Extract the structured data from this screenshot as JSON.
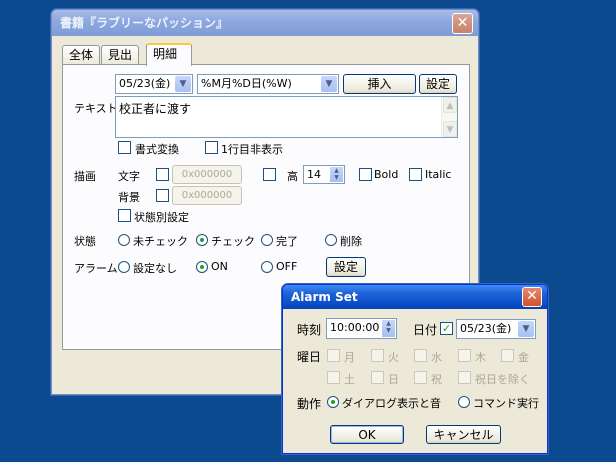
{
  "main": {
    "title": "書籍『ラブリーなパッション』",
    "tabs": [
      "全体",
      "見出",
      "明細"
    ],
    "date_value": "05/23(金)",
    "format_value": "%M月%D日(%W)",
    "insert_label": "挿入",
    "settings_label": "設定",
    "text_label": "テキスト",
    "text_value": "校正者に渡す",
    "format_convert_label": "書式変換",
    "hide_first_line_label": "1行目非表示",
    "draw_label": "描画",
    "char_label": "文字",
    "char_color": "0x000000",
    "height_label": "高",
    "height_value": "14",
    "bold_label": "Bold",
    "italic_label": "Italic",
    "bg_label": "背景",
    "bg_color": "0x000000",
    "state_setting_label": "状態別設定",
    "state_label": "状態",
    "state_options": [
      "未チェック",
      "チェック",
      "完了",
      "削除"
    ],
    "alarm_label": "アラーム",
    "alarm_options": [
      "設定なし",
      "ON",
      "OFF"
    ],
    "alarm_settings_label": "設定"
  },
  "alarm": {
    "title": "Alarm Set",
    "time_label": "時刻",
    "time_value": "10:00:00",
    "date_label": "日付",
    "date_value": "05/23(金)",
    "weekday_label": "曜日",
    "weekdays_row1": [
      "月",
      "火",
      "水",
      "木",
      "金"
    ],
    "weekdays_row2": [
      "土",
      "日",
      "祝",
      "祝日を除く"
    ],
    "action_label": "動作",
    "action_options": [
      "ダイアログ表示と音",
      "コマンド実行"
    ],
    "ok_label": "OK",
    "cancel_label": "キャンセル"
  }
}
